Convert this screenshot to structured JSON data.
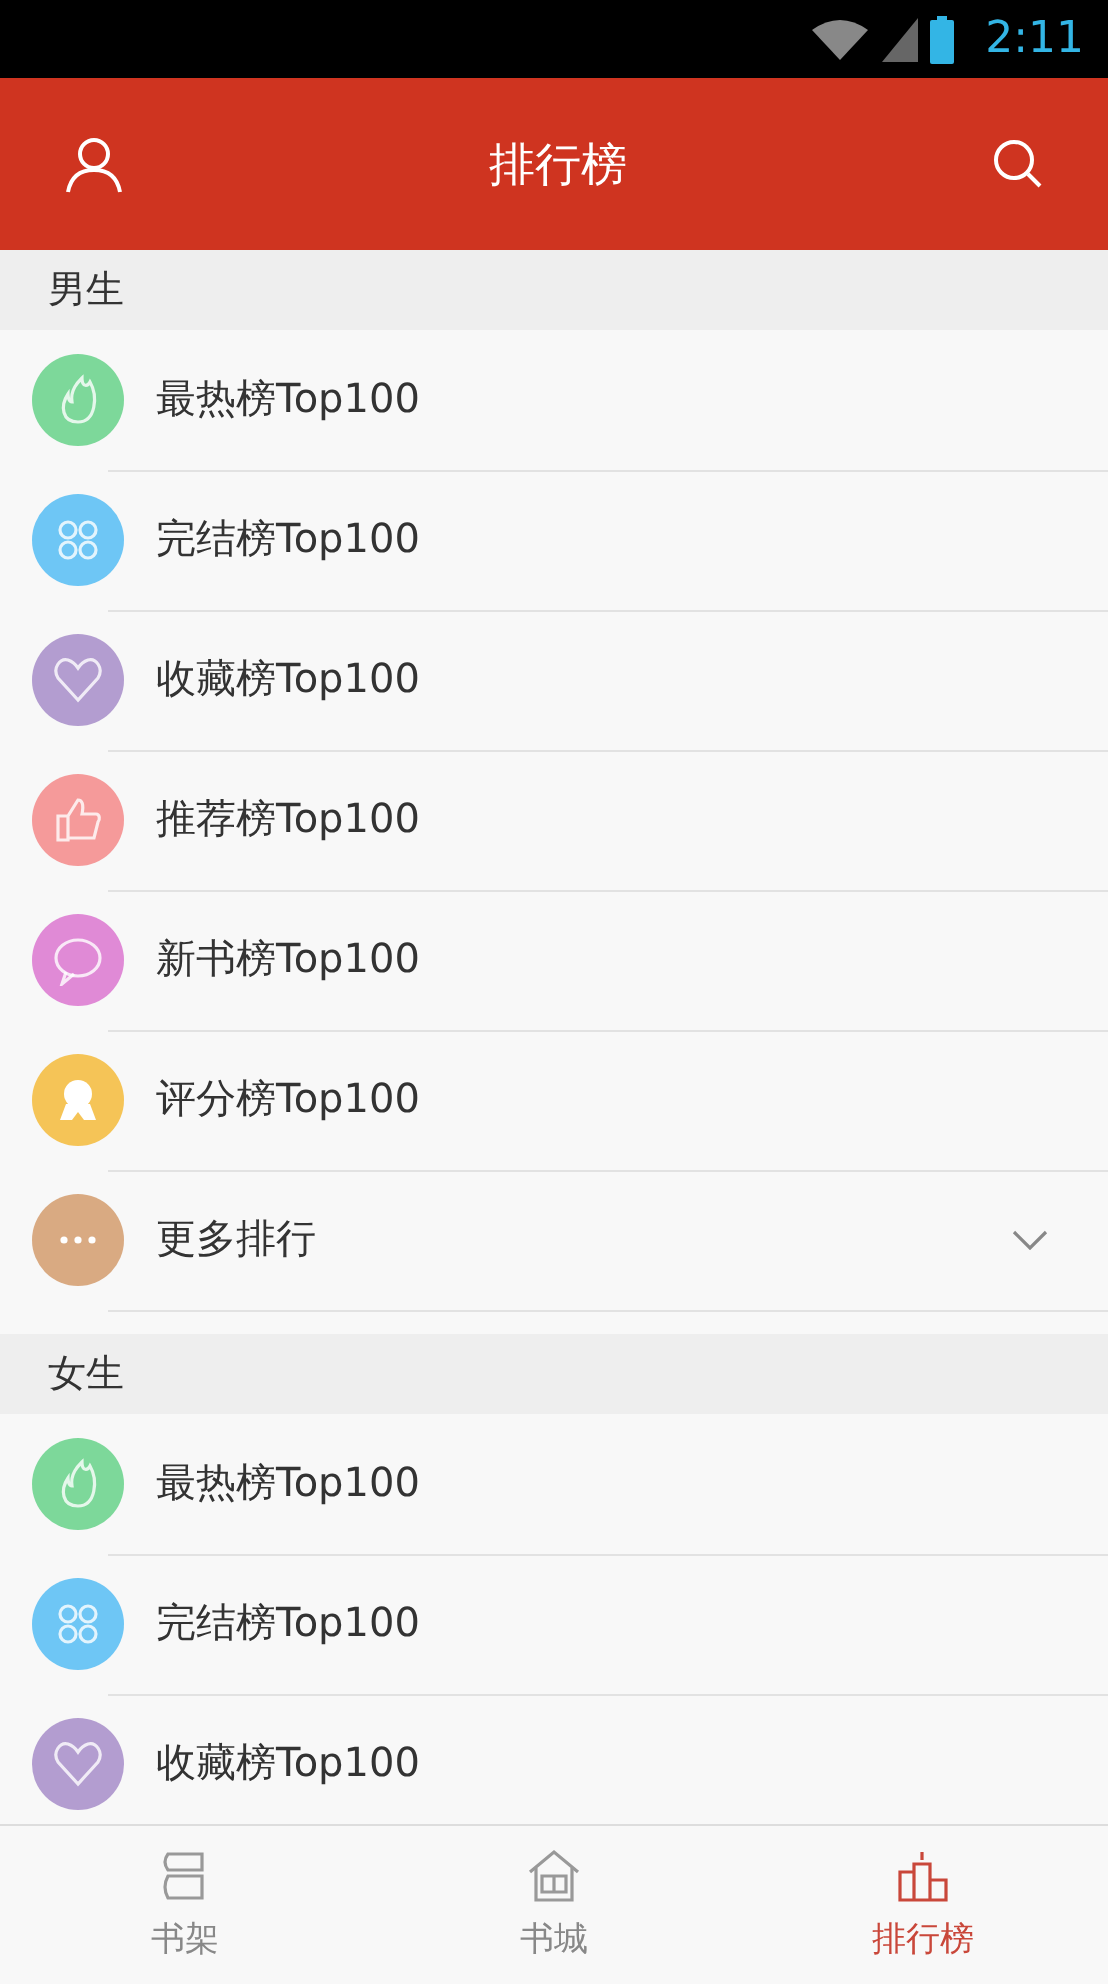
{
  "status_bar": {
    "time": "2:11"
  },
  "header": {
    "title": "排行榜"
  },
  "sections": [
    {
      "title": "男生",
      "items": [
        {
          "label": "最热榜Top100",
          "kind": "fire",
          "color": "#7dd89a"
        },
        {
          "label": "完结榜Top100",
          "kind": "grid",
          "color": "#6ec6f5"
        },
        {
          "label": "收藏榜Top100",
          "kind": "heart",
          "color": "#b39dd0"
        },
        {
          "label": "推荐榜Top100",
          "kind": "thumb",
          "color": "#f59a9a"
        },
        {
          "label": "新书榜Top100",
          "kind": "new",
          "color": "#e08ad6"
        },
        {
          "label": "评分榜Top100",
          "kind": "medal",
          "color": "#f5c457"
        },
        {
          "label": "更多排行",
          "kind": "more",
          "color": "#d9aa82"
        }
      ]
    },
    {
      "title": "女生",
      "items": [
        {
          "label": "最热榜Top100",
          "kind": "fire",
          "color": "#7dd89a"
        },
        {
          "label": "完结榜Top100",
          "kind": "grid",
          "color": "#6ec6f5"
        },
        {
          "label": "收藏榜Top100",
          "kind": "heart",
          "color": "#b39dd0"
        }
      ]
    }
  ],
  "tabs": [
    {
      "label": "书架",
      "kind": "shelf",
      "selected": false
    },
    {
      "label": "书城",
      "kind": "store",
      "selected": false
    },
    {
      "label": "排行榜",
      "kind": "rank",
      "selected": true
    }
  ]
}
